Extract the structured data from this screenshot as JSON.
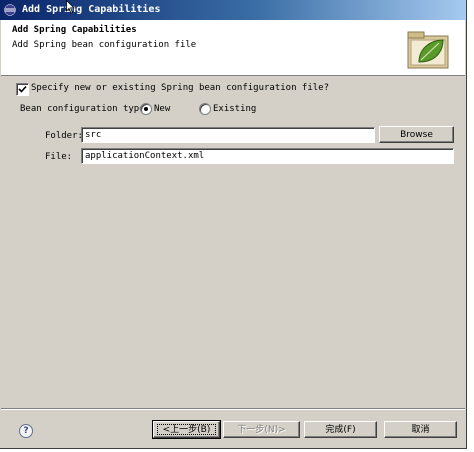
{
  "window": {
    "title": "Add Spring Capabilities"
  },
  "header": {
    "title": "Add Spring Capabilities",
    "description": "Add Spring bean configuration file"
  },
  "form": {
    "specify_checkbox": {
      "label": "Specify new or existing Spring bean configuration file?",
      "checked": true
    },
    "bean_type": {
      "label": "Bean configuration type:",
      "options": [
        {
          "label": "New",
          "selected": true
        },
        {
          "label": "Existing",
          "selected": false
        }
      ]
    },
    "folder": {
      "label": "Folder:",
      "value": "src",
      "browse_label": "Browse"
    },
    "file": {
      "label": "File:",
      "value": "applicationContext.xml"
    }
  },
  "footer": {
    "back_label": "<上一步(B)",
    "next_label": "下一步(N)>",
    "finish_label": "完成(F)",
    "cancel_label": "取消"
  },
  "colors": {
    "titlebar_start": "#0a246a",
    "titlebar_end": "#a6caf0",
    "dialog_bg": "#d4d0c8"
  }
}
